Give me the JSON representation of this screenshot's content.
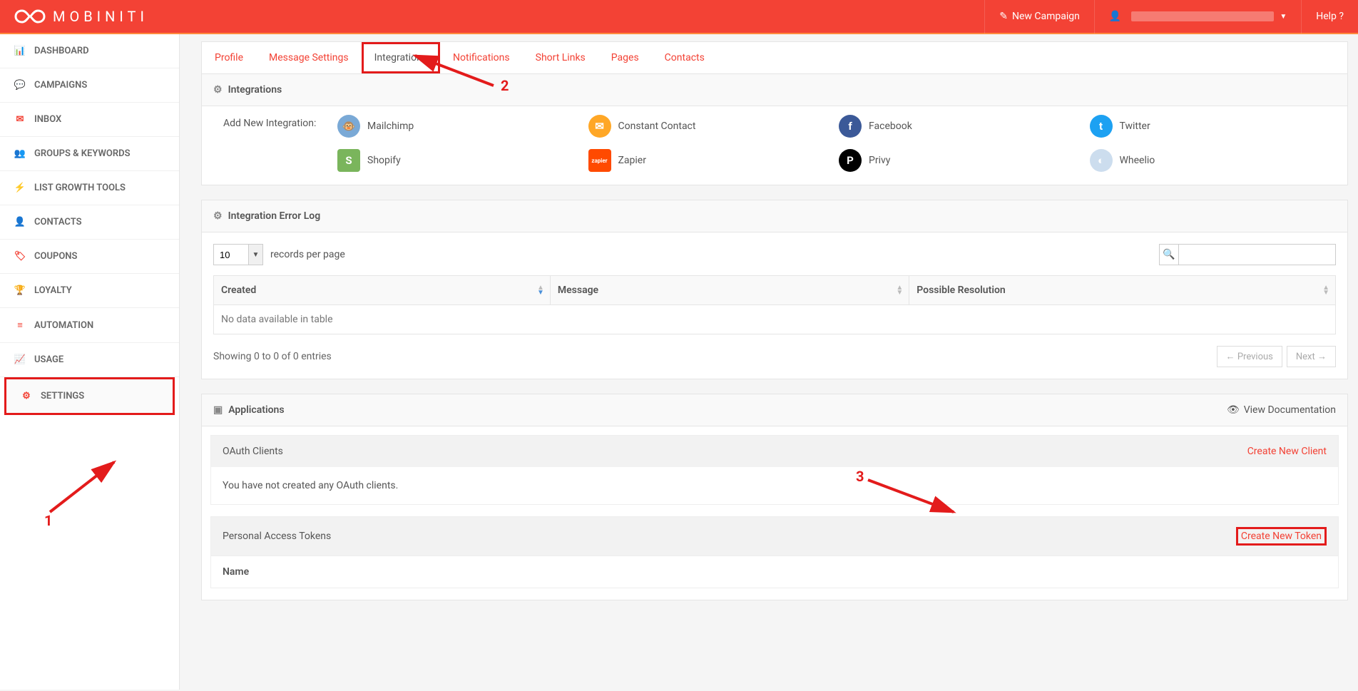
{
  "brand": "MOBINITI",
  "topbar": {
    "new_campaign": "New Campaign",
    "help": "Help ?"
  },
  "sidebar": {
    "items": [
      {
        "label": "DASHBOARD",
        "icon": "dashboard"
      },
      {
        "label": "CAMPAIGNS",
        "icon": "chat"
      },
      {
        "label": "INBOX",
        "icon": "mail"
      },
      {
        "label": "GROUPS & KEYWORDS",
        "icon": "users"
      },
      {
        "label": "LIST GROWTH TOOLS",
        "icon": "bolt"
      },
      {
        "label": "CONTACTS",
        "icon": "user"
      },
      {
        "label": "COUPONS",
        "icon": "tag"
      },
      {
        "label": "LOYALTY",
        "icon": "trophy"
      },
      {
        "label": "AUTOMATION",
        "icon": "bars"
      },
      {
        "label": "USAGE",
        "icon": "chart"
      },
      {
        "label": "SETTINGS",
        "icon": "gear"
      }
    ]
  },
  "tabs": [
    "Profile",
    "Message Settings",
    "Integrations",
    "Notifications",
    "Short Links",
    "Pages",
    "Contacts"
  ],
  "active_tab": "Integrations",
  "integrations_panel": {
    "title": "Integrations",
    "add_label": "Add New Integration:",
    "items": [
      {
        "name": "Mailchimp",
        "color": "#7aa9d6",
        "shape": "round",
        "glyph": "🐵"
      },
      {
        "name": "Constant Contact",
        "color": "#ffa726",
        "shape": "round",
        "glyph": "✉"
      },
      {
        "name": "Facebook",
        "color": "#3b5998",
        "shape": "round",
        "glyph": "f"
      },
      {
        "name": "Twitter",
        "color": "#1da1f2",
        "shape": "round",
        "glyph": "t"
      },
      {
        "name": "Shopify",
        "color": "#7ab55c",
        "shape": "sq",
        "glyph": "S"
      },
      {
        "name": "Zapier",
        "color": "#ff4a00",
        "shape": "sq",
        "glyph": "zapier"
      },
      {
        "name": "Privy",
        "color": "#000000",
        "shape": "round",
        "glyph": "P"
      },
      {
        "name": "Wheelio",
        "color": "#cde",
        "shape": "round",
        "glyph": "◐"
      }
    ]
  },
  "errorlog": {
    "title": "Integration Error Log",
    "records_value": "10",
    "records_label": "records per page",
    "columns": [
      "Created",
      "Message",
      "Possible Resolution"
    ],
    "empty": "No data available in table",
    "info": "Showing 0 to 0 of 0 entries",
    "prev": "← Previous",
    "next": "Next →"
  },
  "apps": {
    "title": "Applications",
    "view_docs": "View Documentation",
    "oauth_title": "OAuth Clients",
    "oauth_link": "Create New Client",
    "oauth_empty": "You have not created any OAuth clients.",
    "pat_title": "Personal Access Tokens",
    "pat_link": "Create New Token",
    "pat_name": "Name"
  },
  "annotations": {
    "a1": "1",
    "a2": "2",
    "a3": "3"
  }
}
